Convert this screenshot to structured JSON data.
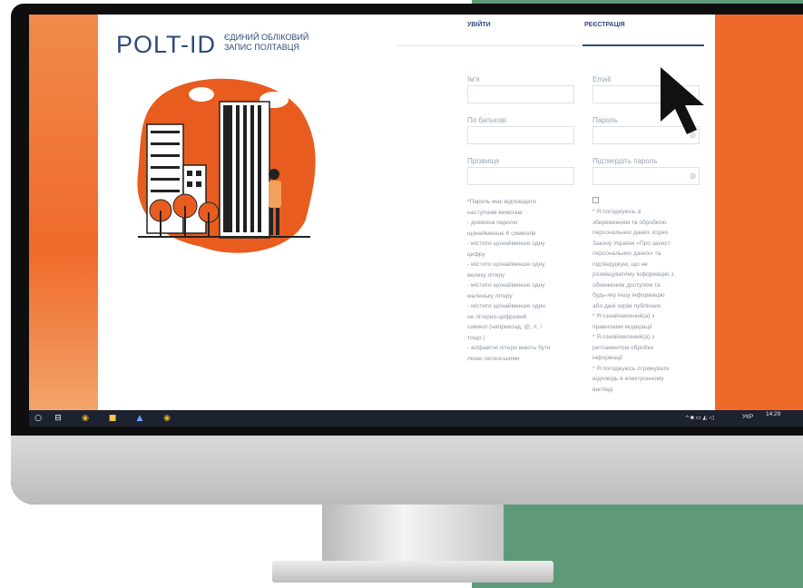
{
  "brand": {
    "logo": "POLT-ID",
    "subtitle_line1": "ЄДИНИЙ ОБЛІКОВИЙ",
    "subtitle_line2": "ЗАПИС ПОЛТАВЦЯ"
  },
  "tabs": {
    "login": "УВІЙТИ",
    "register": "РЕЄСТРАЦІЯ"
  },
  "form": {
    "first_name": "Ім'я",
    "email": "Email",
    "patronymic": "По батькові",
    "password": "Пароль",
    "last_name": "Прізвище",
    "confirm_password": "Підтвердіть пароль"
  },
  "password_rules": "*Пароль має відповідати\nнаступним вимогам:\n- довжина паролю\nщонайменше 6 символів\n- містити щонайменше одну\nцифру\n- містити щонайменше одну\nвелику літеру\n- містити щонайменше одну\nмаленьку літеру\n- містити щонайменше один\nне літерно-цифровий\nсимвол (наприклад, @, #, !\nтощо )\n- алфавітні літери мають бути\nлише латинськими",
  "consent_text": "* Я погоджуюсь зі\nзбереженням та обробкою\nперсональних даних згідно\nЗакону України «Про захист\nперсональних даних» та\nпідтверджую, що не\nрозміщуватиму інформацію з\nобмеженим доступом та\nбудь-яку іншу інформацію\nабо дані окрім публічних\n* Я ознайомлений(а) з\nправилами модерації\n* Я ознайомлений(а) з\nрегламентом обробки\nінформації\n* Я погоджуюсь отримувати\nвідповідь в електронному\nвигляді",
  "taskbar": {
    "lang": "УКР",
    "time": "14:29"
  },
  "colors": {
    "accent": "#2f4a7a",
    "orange": "#ef6a2a",
    "green": "#5f9a78"
  }
}
